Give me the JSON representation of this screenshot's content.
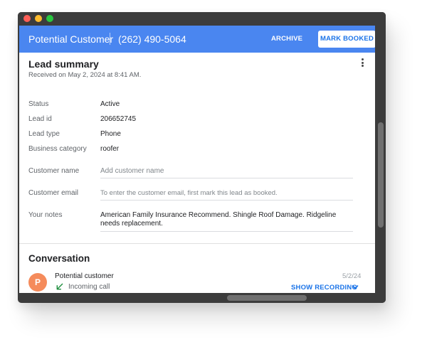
{
  "header": {
    "customer_name": "Potential Customer",
    "phone": "(262) 490-5064",
    "archive_label": "ARCHIVE",
    "mark_booked_label": "MARK BOOKED"
  },
  "summary": {
    "title": "Lead summary",
    "received": "Received on May 2, 2024 at 8:41 AM.",
    "rows": [
      {
        "label": "Status",
        "value": "Active"
      },
      {
        "label": "Lead id",
        "value": "206652745"
      },
      {
        "label": "Lead type",
        "value": "Phone"
      },
      {
        "label": "Business category",
        "value": "roofer"
      }
    ],
    "customer_name_label": "Customer name",
    "customer_name_placeholder": "Add customer name",
    "customer_email_label": "Customer email",
    "customer_email_placeholder": "To enter the customer email, first mark this lead as booked.",
    "notes_label": "Your notes",
    "notes_value": "American Family Insurance Recommend. Shingle Roof Damage. Ridgeline needs replacement."
  },
  "conversation": {
    "title": "Conversation",
    "avatar_initial": "P",
    "customer": "Potential customer",
    "call_type": "Incoming call",
    "date": "5/2/24",
    "show_recording_label": "SHOW RECORDING"
  },
  "colors": {
    "header_bg": "#4a86f0",
    "accent": "#1a73e8",
    "avatar_bg": "#f58b5b",
    "incoming_call_icon": "#1e8e3e"
  },
  "icons": {
    "more": "more-vertical-icon",
    "call": "incoming-call-arrow-icon",
    "expand": "chevron-down-icon"
  }
}
